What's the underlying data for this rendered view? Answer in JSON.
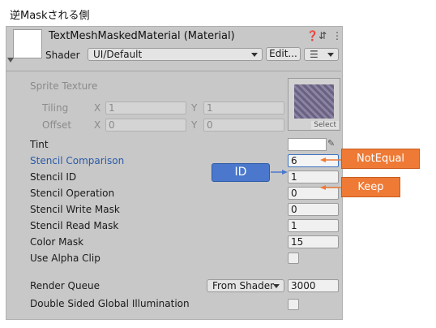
{
  "caption": "逆Maskされる側",
  "header": {
    "title": "TextMeshMaskedMaterial (Material)",
    "shader_label": "Shader",
    "shader_value": "UI/Default",
    "edit_button": "Edit...",
    "icons": [
      "help-icon",
      "preset-icon",
      "more-icon",
      "list-icon"
    ]
  },
  "properties": {
    "sprite_texture": "Sprite Texture",
    "tiling": "Tiling",
    "offset": "Offset",
    "x": "X",
    "y": "Y",
    "tiling_x": "1",
    "tiling_y": "1",
    "offset_x": "0",
    "offset_y": "0",
    "select": "Select",
    "tint": "Tint",
    "stencil_comparison": "Stencil Comparison",
    "stencil_comparison_value": "6",
    "stencil_id": "Stencil ID",
    "stencil_id_value": "1",
    "stencil_operation": "Stencil Operation",
    "stencil_operation_value": "0",
    "stencil_write_mask": "Stencil Write Mask",
    "stencil_write_mask_value": "0",
    "stencil_read_mask": "Stencil Read Mask",
    "stencil_read_mask_value": "1",
    "color_mask": "Color Mask",
    "color_mask_value": "15",
    "use_alpha_clip": "Use Alpha Clip",
    "render_queue": "Render Queue",
    "render_queue_dropdown": "From Shader",
    "render_queue_value": "3000",
    "double_sided": "Double Sided Global Illumination"
  },
  "annotations": {
    "not_equal": "NotEqual",
    "id": "ID",
    "keep": "Keep"
  },
  "colors": {
    "callout_orange": "#ee7a36",
    "id_blue": "#4b78cc",
    "panel_gray": "#c8c8c8"
  }
}
